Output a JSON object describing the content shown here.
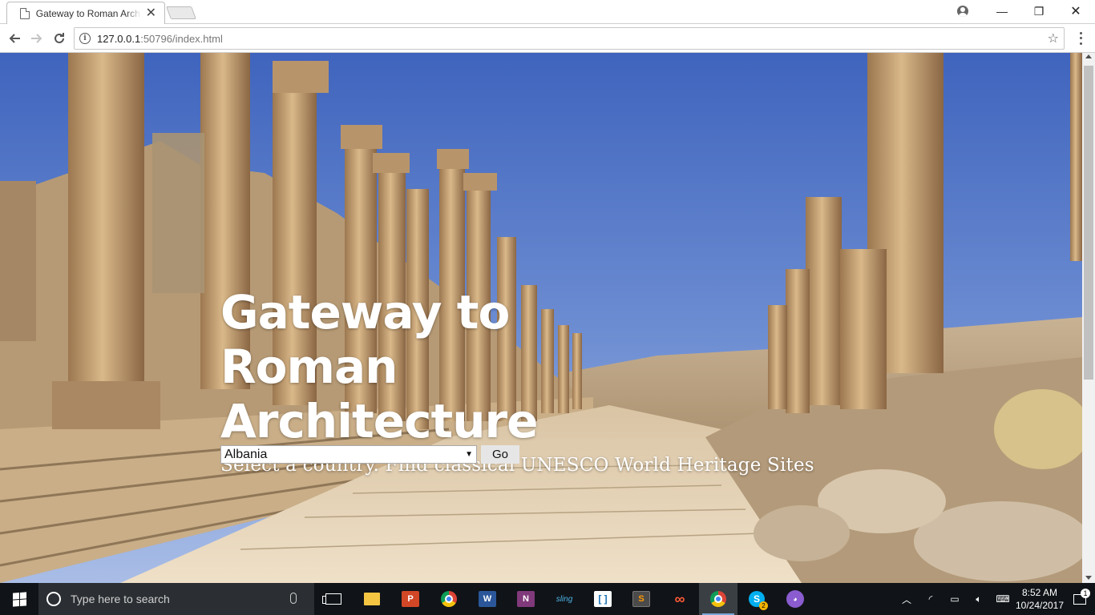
{
  "browser": {
    "tab_title": "Gateway to Roman Architecture",
    "tab_close": "✕",
    "url_host": "127.0.0.1",
    "url_rest": ":50796/index.html",
    "window_controls": {
      "minimize": "—",
      "maximize": "❐",
      "close": "✕"
    },
    "star": "☆"
  },
  "page": {
    "title": "Gateway to Roman Architecture",
    "subtitle": "Select a country. Find classical UNESCO World Heritage Sites",
    "country_select": {
      "selected": "Albania"
    },
    "go_button": "Go"
  },
  "taskbar": {
    "search_placeholder": "Type here to search",
    "apps": [
      "task-view",
      "file-explorer",
      "powerpoint",
      "chrome",
      "word",
      "onenote",
      "sling",
      "brackets",
      "sublime-text",
      "infinity",
      "chrome",
      "skype",
      "github-desktop"
    ],
    "skype_badge": "2",
    "time": "8:52 AM",
    "date": "10/24/2017",
    "notification_count": "1"
  }
}
